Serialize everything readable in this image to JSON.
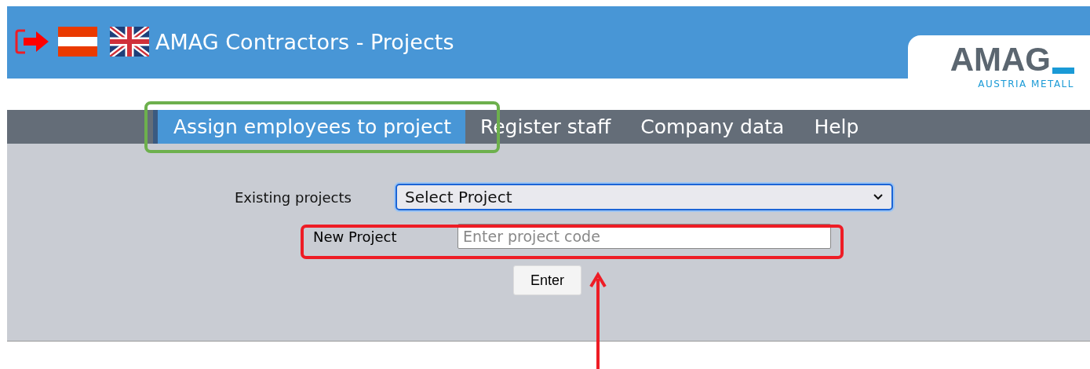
{
  "header": {
    "title": "AMAG Contractors - Projects",
    "logo": {
      "wordmark": "AMAG",
      "tagline": "AUSTRIA METALL"
    }
  },
  "nav": [
    {
      "label": "Assign employees to project",
      "selected": true
    },
    {
      "label": "Register staff",
      "selected": false
    },
    {
      "label": "Company data",
      "selected": false
    },
    {
      "label": "Help",
      "selected": false
    }
  ],
  "form": {
    "existing_label": "Existing projects",
    "select_value": "Select Project",
    "new_label": "New Project",
    "placeholder": "Enter project code",
    "button": "Enter"
  }
}
